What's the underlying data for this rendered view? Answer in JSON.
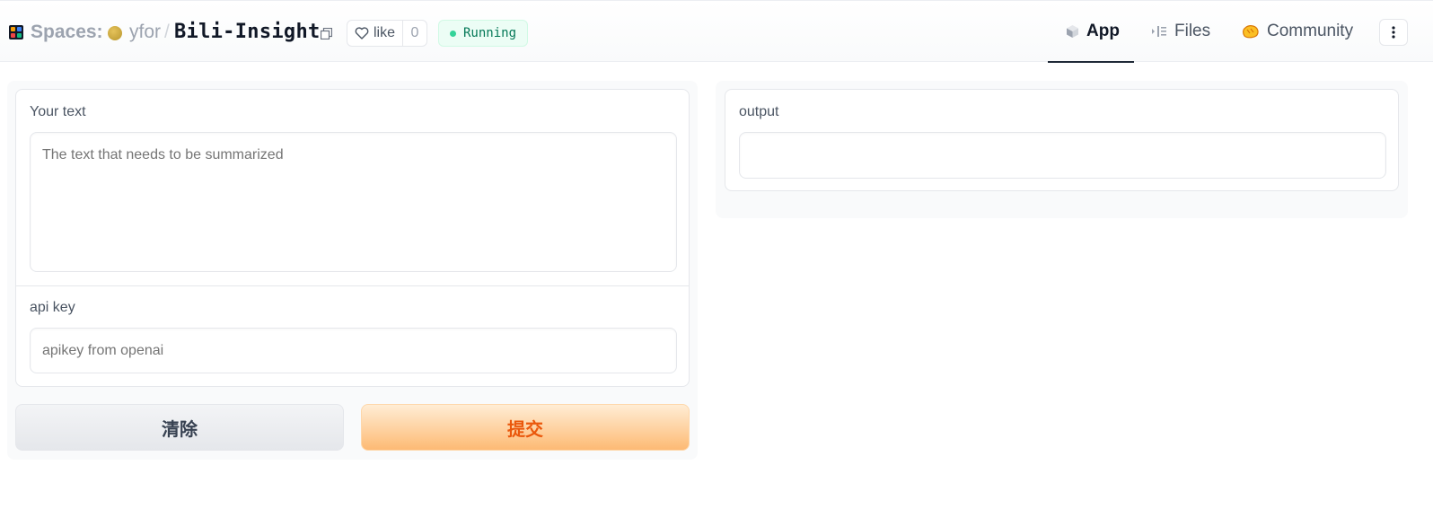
{
  "header": {
    "spaces_label": "Spaces:",
    "owner": "yfor",
    "separator": "/",
    "repo": "Bili-Insight",
    "like_label": "like",
    "like_count": "0",
    "status": "Running",
    "status_color": "#34d399",
    "logo_colors": [
      "#f59e0b",
      "#3b82f6",
      "#ef4444",
      "#10b981"
    ]
  },
  "nav": {
    "tabs": [
      {
        "label": "App",
        "icon": "app-cube-icon",
        "active": true
      },
      {
        "label": "Files",
        "icon": "files-icon",
        "active": false
      },
      {
        "label": "Community",
        "icon": "community-icon",
        "active": false
      }
    ],
    "more_icon": "vertical-dots-icon"
  },
  "form": {
    "text_label": "Your text",
    "text_placeholder": "The text that needs to be summarized",
    "text_value": "",
    "apikey_label": "api key",
    "apikey_placeholder": "apikey from openai",
    "apikey_value": ""
  },
  "buttons": {
    "clear": "清除",
    "submit": "提交",
    "submit_color": "#ea580c"
  },
  "output": {
    "label": "output",
    "value": ""
  }
}
